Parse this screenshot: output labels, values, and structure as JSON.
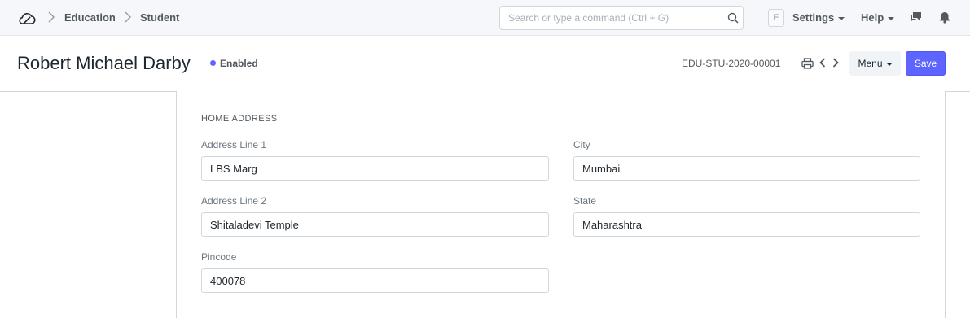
{
  "navbar": {
    "breadcrumbs": [
      "Education",
      "Student"
    ],
    "search_placeholder": "Search or type a command (Ctrl + G)",
    "user_initial": "E",
    "settings_label": "Settings",
    "help_label": "Help",
    "icons": {
      "logo": "cloud-logo-icon",
      "search": "search-icon",
      "chat": "chat-icon",
      "notifications": "bell-icon"
    }
  },
  "page_head": {
    "title": "Robert Michael Darby",
    "status": "Enabled",
    "status_color": "#5e64ff",
    "doc_id": "EDU-STU-2020-00001",
    "menu_label": "Menu",
    "save_label": "Save",
    "accent_color": "#5e64ff"
  },
  "form": {
    "section_title": "HOME ADDRESS",
    "fields": {
      "address_line_1": {
        "label": "Address Line 1",
        "value": "LBS Marg"
      },
      "address_line_2": {
        "label": "Address Line 2",
        "value": "Shitaladevi Temple"
      },
      "pincode": {
        "label": "Pincode",
        "value": "400078"
      },
      "city": {
        "label": "City",
        "value": "Mumbai"
      },
      "state": {
        "label": "State",
        "value": "Maharashtra"
      }
    }
  }
}
